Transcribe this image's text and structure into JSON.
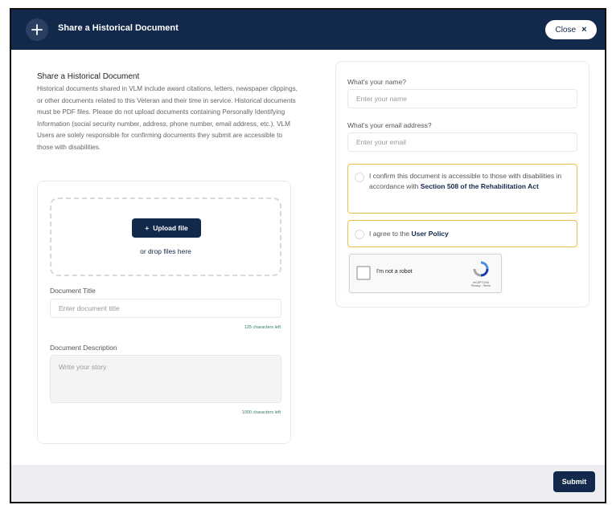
{
  "header": {
    "title": "Share a Historical Document",
    "close_label": "Close",
    "close_icon": "×"
  },
  "intro": {
    "heading": "Share a Historical Document",
    "body": "Historical documents shared in VLM include award citations, letters, newspaper clippings, or other documents related to this Veteran and their time in service. Historical documents must be PDF files. Please do not upload documents containing Personally Identifying Information (social security number, address, phone number, email address, etc.). VLM Users are solely responsible for confirming documents they submit are accessible to those with disabilities."
  },
  "upload": {
    "button_label": "Upload file",
    "drop_text": "or drop files here"
  },
  "document_title": {
    "label": "Document Title",
    "placeholder": "Enter document title",
    "counter": "125 characters left"
  },
  "document_description": {
    "label": "Document Description",
    "placeholder": "Write your story",
    "counter": "1000 characters left"
  },
  "name_field": {
    "label": "What's your name?",
    "placeholder": "Enter your name"
  },
  "email_field": {
    "label": "What's your email address?",
    "placeholder": "Enter your email"
  },
  "accessibility_check": {
    "text_before": "I confirm this document is accessible to those with disabilities in accordance with ",
    "link_text": "Section 508 of the Rehabilitation Act"
  },
  "policy_check": {
    "text_before": "I agree to the ",
    "link_text": "User Policy"
  },
  "recaptcha": {
    "label": "I'm not a robot",
    "brand": "reCAPTCHA",
    "links": "Privacy - Terms"
  },
  "footer": {
    "submit_label": "Submit"
  },
  "colors": {
    "navy": "#13294b",
    "warning_border": "#f0bd4d",
    "counter_green": "#2f7d5b"
  }
}
